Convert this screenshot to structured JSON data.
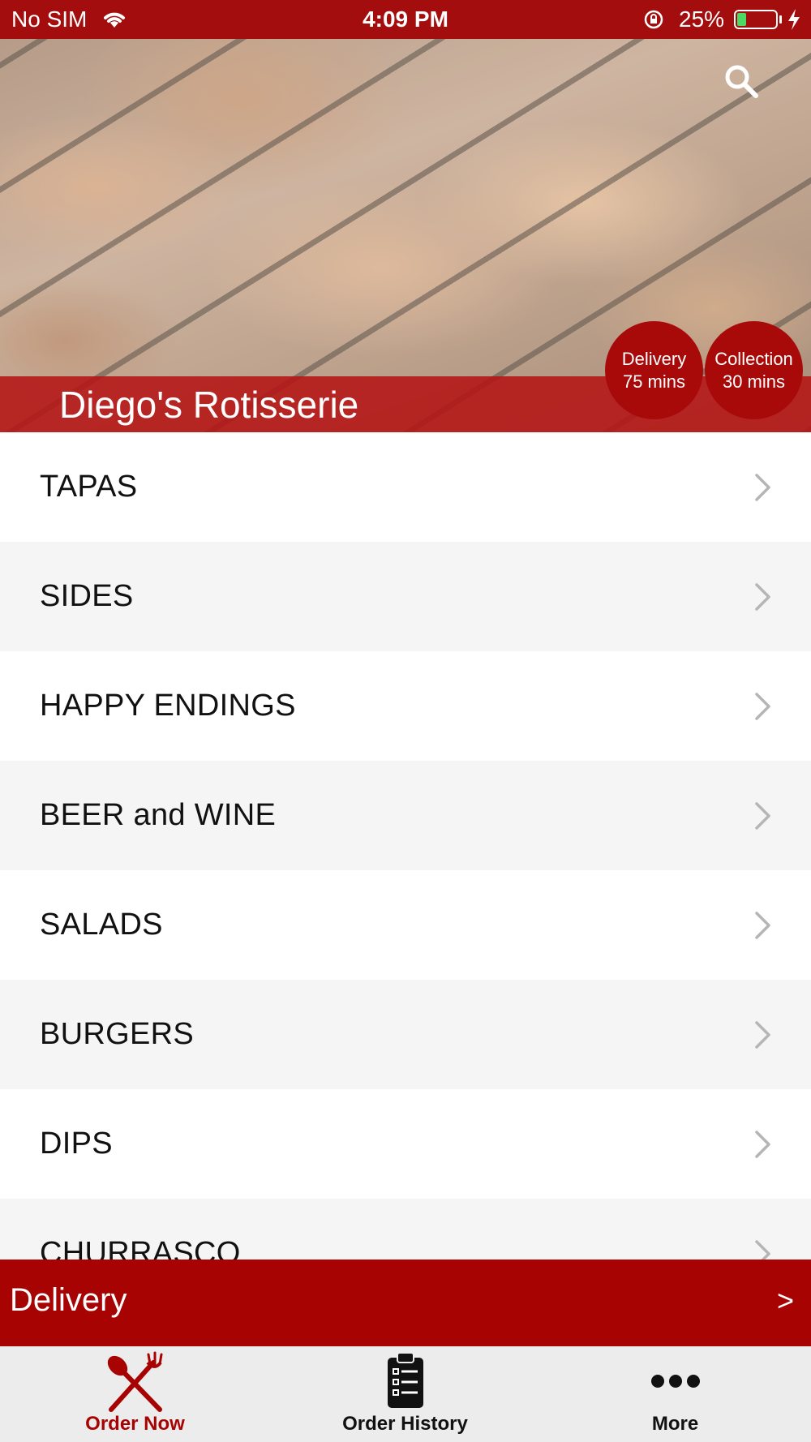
{
  "status_bar": {
    "carrier": "No SIM",
    "time": "4:09 PM",
    "battery_percent": "25%",
    "battery_level": 0.25,
    "icons": [
      "wifi-icon",
      "orientation-lock-icon",
      "battery-icon",
      "charging-bolt-icon"
    ]
  },
  "header": {
    "restaurant_name": "Diego's Rotisserie",
    "search_icon": "search-icon",
    "delivery_pill": {
      "line1": "Delivery",
      "line2": "75 mins"
    },
    "collection_pill": {
      "line1": "Collection",
      "line2": "30 mins"
    }
  },
  "menu": {
    "categories": [
      {
        "label": "TAPAS"
      },
      {
        "label": "SIDES"
      },
      {
        "label": "HAPPY ENDINGS"
      },
      {
        "label": "BEER and WINE"
      },
      {
        "label": "SALADS"
      },
      {
        "label": "BURGERS"
      },
      {
        "label": "DIPS"
      },
      {
        "label": "CHURRASCO"
      }
    ]
  },
  "delivery_bar": {
    "label": "Delivery",
    "arrow": ">"
  },
  "tab_bar": {
    "tabs": [
      {
        "label": "Order Now",
        "icon": "fork-knife-icon",
        "active": true
      },
      {
        "label": "Order History",
        "icon": "clipboard-list-icon",
        "active": false
      },
      {
        "label": "More",
        "icon": "more-dots-icon",
        "active": false
      }
    ]
  },
  "colors": {
    "brand_red": "#a80303",
    "status_bar": "#a30d0d",
    "row_alt": "#f5f5f5",
    "tab_bar": "#ececec"
  }
}
